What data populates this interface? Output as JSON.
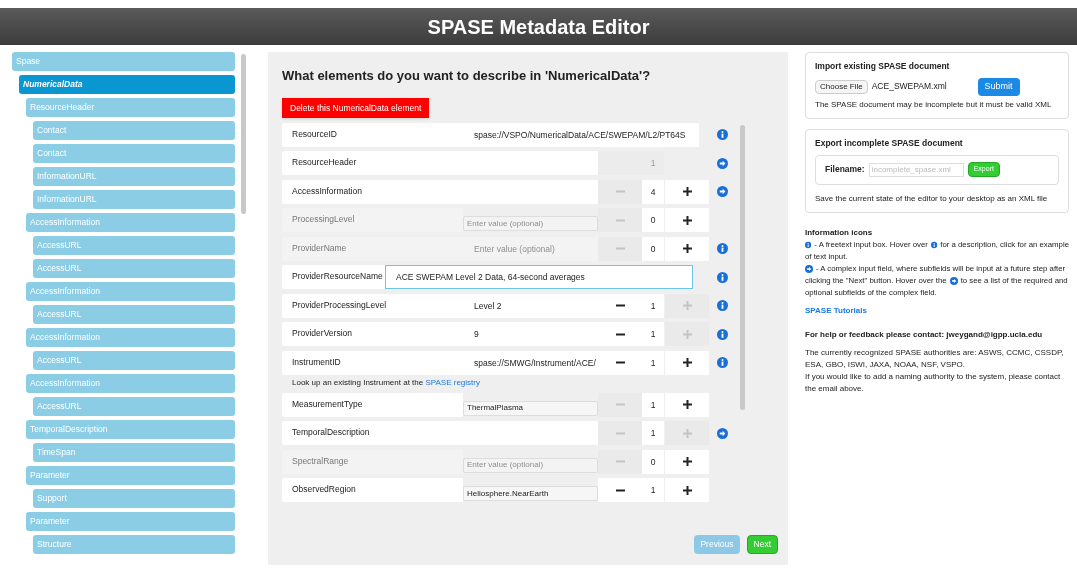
{
  "header": {
    "title": "SPASE Metadata Editor"
  },
  "sidebar": {
    "items": [
      {
        "label": "Spase",
        "selected": false,
        "children": [
          {
            "label": "NumericalData",
            "selected": true,
            "children": [
              {
                "label": "ResourceHeader",
                "selected": false,
                "children": [
                  {
                    "label": "Contact",
                    "selected": false
                  },
                  {
                    "label": "Contact",
                    "selected": false
                  },
                  {
                    "label": "InformationURL",
                    "selected": false
                  },
                  {
                    "label": "InformationURL",
                    "selected": false
                  }
                ]
              },
              {
                "label": "AccessInformation",
                "selected": false,
                "children": [
                  {
                    "label": "AccessURL",
                    "selected": false
                  },
                  {
                    "label": "AccessURL",
                    "selected": false
                  }
                ]
              },
              {
                "label": "AccessInformation",
                "selected": false,
                "children": [
                  {
                    "label": "AccessURL",
                    "selected": false
                  }
                ]
              },
              {
                "label": "AccessInformation",
                "selected": false,
                "children": [
                  {
                    "label": "AccessURL",
                    "selected": false
                  }
                ]
              },
              {
                "label": "AccessInformation",
                "selected": false,
                "children": [
                  {
                    "label": "AccessURL",
                    "selected": false
                  }
                ]
              },
              {
                "label": "TemporalDescription",
                "selected": false,
                "children": [
                  {
                    "label": "TimeSpan",
                    "selected": false
                  }
                ]
              },
              {
                "label": "Parameter",
                "selected": false,
                "children": [
                  {
                    "label": "Support",
                    "selected": false
                  }
                ]
              },
              {
                "label": "Parameter",
                "selected": false,
                "children": [
                  {
                    "label": "Structure",
                    "selected": false
                  }
                ]
              }
            ]
          }
        ]
      }
    ]
  },
  "main": {
    "heading": "What elements do you want to describe in 'NumericalData'?",
    "delete_button": "Delete this NumericalData element",
    "rows": [
      {
        "kind": "freetext",
        "label": "ResourceID",
        "optional": false,
        "field": {
          "kind": "text",
          "value": "spase://VSPO/NumericalData/ACE/SWEPAM/L2/PT64S",
          "focused": false
        }
      },
      {
        "kind": "complex",
        "label": "ResourceHeader",
        "optional": false,
        "stepper": {
          "count": "1",
          "count_disabled": true
        }
      },
      {
        "kind": "complex",
        "label": "AccessInformation",
        "optional": false,
        "stepper": {
          "minus_enabled": false,
          "count": "4",
          "plus_enabled": true
        }
      },
      {
        "kind": "plain",
        "label": "ProcessingLevel",
        "optional": true,
        "field": {
          "kind": "select",
          "placeholder": "Enter value (optional)"
        },
        "stepper": {
          "minus_enabled": false,
          "count": "0",
          "plus_enabled": true
        }
      },
      {
        "kind": "freetext",
        "label": "ProviderName",
        "optional": true,
        "field": {
          "kind": "text",
          "placeholder": "Enter value (optional)"
        },
        "stepper": {
          "minus_enabled": false,
          "count": "0",
          "plus_enabled": true
        }
      },
      {
        "kind": "freetext",
        "label": "ProviderResourceName",
        "optional": false,
        "field": {
          "kind": "text",
          "value": "ACE SWEPAM Level 2 Data, 64-second averages",
          "focused": true
        }
      },
      {
        "kind": "freetext",
        "label": "ProviderProcessingLevel",
        "optional": false,
        "field": {
          "kind": "text",
          "value": "Level 2"
        },
        "stepper": {
          "minus_enabled": true,
          "count": "1",
          "plus_enabled": false
        }
      },
      {
        "kind": "freetext",
        "label": "ProviderVersion",
        "optional": false,
        "field": {
          "kind": "text",
          "value": "9"
        },
        "stepper": {
          "minus_enabled": true,
          "count": "1",
          "plus_enabled": false
        }
      },
      {
        "kind": "freetext",
        "label": "InstrumentID",
        "optional": false,
        "field": {
          "kind": "text",
          "value": "spase://SMWG/Instrument/ACE/"
        },
        "stepper": {
          "minus_enabled": true,
          "count": "1",
          "plus_enabled": true
        },
        "note": {
          "text": "Look up an existing Instrument at the",
          "link": "SPASE registry"
        }
      },
      {
        "kind": "plain",
        "label": "MeasurementType",
        "optional": false,
        "field": {
          "kind": "select",
          "value": "ThermalPlasma"
        },
        "stepper": {
          "minus_enabled": false,
          "count": "1",
          "plus_enabled": true
        }
      },
      {
        "kind": "complex",
        "label": "TemporalDescription",
        "optional": false,
        "stepper": {
          "minus_enabled": false,
          "count": "1",
          "plus_enabled": false
        }
      },
      {
        "kind": "plain",
        "label": "SpectralRange",
        "optional": true,
        "field": {
          "kind": "select",
          "placeholder": "Enter value (optional)"
        },
        "stepper": {
          "minus_enabled": false,
          "count": "0",
          "plus_enabled": true
        }
      },
      {
        "kind": "plain",
        "label": "ObservedRegion",
        "optional": false,
        "field": {
          "kind": "select",
          "value": "Heliosphere.NearEarth"
        },
        "stepper": {
          "minus_enabled": true,
          "count": "1",
          "plus_enabled": true
        }
      }
    ],
    "previous_button": {
      "label": "Previous",
      "disabled": true
    },
    "next_button": {
      "label": "Next",
      "disabled": false
    }
  },
  "import_card": {
    "title": "Import existing SPASE document",
    "choose_button": "Choose File",
    "file_name": "ACE_SWEPAM.xml",
    "submit_button": "Submit",
    "note": "The SPASE document may be incomplete but it must be valid XML"
  },
  "export_card": {
    "title": "Export incomplete SPASE document",
    "filename_label": "Filename:",
    "filename_placeholder": "incomplete_spase.xml",
    "export_button": "Export",
    "note": "Save the current state of the editor to your desktop as an XML file"
  },
  "info": {
    "title": "Information icons",
    "items": [
      {
        "kind": "freetext",
        "lines": [
          [
            {
              "kind": "icon"
            },
            {
              "kind": "text",
              "text": "- A freetext input box. Hover over"
            },
            {
              "kind": "icon"
            },
            {
              "kind": "text",
              "text": "for a description, click for an example"
            }
          ],
          [
            {
              "kind": "text",
              "text": "of text input."
            }
          ]
        ]
      },
      {
        "kind": "complex",
        "lines": [
          [
            {
              "kind": "icon"
            },
            {
              "kind": "text",
              "text": "- A complex input field, where subfields will be input at a future step after"
            }
          ],
          [
            {
              "kind": "text",
              "text": "clicking the \"Next\" button. Hover over the"
            },
            {
              "kind": "icon"
            },
            {
              "kind": "text",
              "text": "to see a list of the required and"
            }
          ],
          [
            {
              "kind": "text",
              "text": "optional subfields of the complex field."
            }
          ]
        ]
      }
    ],
    "tutorials_link": "SPASE Tutorials",
    "help": "For help or feedback please contact:  jweygand@igpp.ucla.edu",
    "authorities": "The currently recognized SPASE authorities are: ASWS, CCMC, CSSDP, ESA, GBO, ISWI, JAXA, NOAA, NSF, VSPO.",
    "naming": "If you would like to add a naming authority to the system, please contact the email above."
  }
}
